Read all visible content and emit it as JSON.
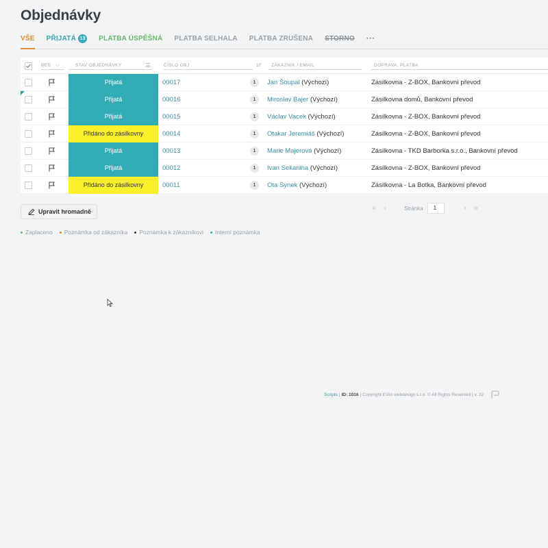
{
  "page": {
    "title": "Objednávky"
  },
  "tabs": [
    {
      "label": "VŠE",
      "state": "active"
    },
    {
      "label": "PŘIJATÁ",
      "badge": "13",
      "state": "received"
    },
    {
      "label": "PLATBA ÚSPĚŠNÁ",
      "state": "paid"
    },
    {
      "label": "PLATBA SELHALA",
      "state": "normal"
    },
    {
      "label": "PLATBA ZRUŠENA",
      "state": "normal"
    },
    {
      "label": "STORNO",
      "state": "storno"
    },
    {
      "label": "···",
      "state": "more"
    }
  ],
  "table": {
    "headers": {
      "flag": "BES",
      "status": "STAV OBJEDNÁVKY",
      "order": "ČÍSLO OBJ",
      "qty": "1F",
      "customer": "ZÁKAZNÍK / EMAIL",
      "shipping": "DOPRAVA, PLATBA"
    },
    "rows": [
      {
        "status": "Přijatá",
        "status_color": "teal",
        "order": "00017",
        "qty": "1",
        "customer_name": "Jan Šoupal",
        "customer_suffix": " (Výchozí)",
        "shipping": "Zásilkovna - Z-BOX, Bankovní převod"
      },
      {
        "status": "Přijatá",
        "status_color": "teal",
        "order": "00016",
        "qty": "1",
        "customer_name": "Miroslav Bajer",
        "customer_suffix": " (Výchozí)",
        "shipping": "Zásilkovna domů, Bankovní převod"
      },
      {
        "status": "Přijatá",
        "status_color": "teal",
        "order": "00015",
        "qty": "1",
        "customer_name": "Václav Vacek",
        "customer_suffix": " (Výchozí)",
        "shipping": "Zásilkovna - Z-BOX, Bankovní převod"
      },
      {
        "status": "Přidáno do zásilkovny",
        "status_color": "yellow",
        "order": "00014",
        "qty": "1",
        "customer_name": "Otakar Jeremiáš",
        "customer_suffix": " (Výchozí)",
        "shipping": "Zásilkovna - Z-BOX, Bankovní převod"
      },
      {
        "status": "Přijatá",
        "status_color": "teal",
        "order": "00013",
        "qty": "1",
        "customer_name": "Marie Majerová",
        "customer_suffix": " (Výchozí)",
        "shipping": "Zásilkovna - TKD Barborka s.r.o., Bankovní převod"
      },
      {
        "status": "Přijatá",
        "status_color": "teal",
        "order": "00012",
        "qty": "1",
        "customer_name": "Ivan Sekanina",
        "customer_suffix": " (Výchozí)",
        "shipping": "Zásilkovna - Z-BOX, Bankovní převod"
      },
      {
        "status": "Přidáno do zásilkovny",
        "status_color": "yellow",
        "order": "00011",
        "qty": "1",
        "customer_name": "Ota Synek",
        "customer_suffix": " (Výchozí)",
        "shipping": "Zásilkovna - La Botka, Bankovní převod"
      }
    ]
  },
  "actions": {
    "bulk_edit": "Upravit hromadně"
  },
  "pager": {
    "label": "Stránka",
    "page": "1"
  },
  "legend": [
    {
      "label": "Zaplaceno",
      "color": "#67b86b"
    },
    {
      "label": "Poznámka od zákazníka",
      "color": "#e38c2f"
    },
    {
      "label": "Poznámka k zákazníkovi",
      "color": "#333333"
    },
    {
      "label": "Interní poznámka",
      "color": "#3aa9bd"
    }
  ],
  "footer": {
    "link": "Scripts",
    "id_label": "ID: 1016",
    "text": " | Copyright EVici webdesign s.r.o. © All Rights Reserved | v. 32",
    "sep": " | "
  },
  "colors": {
    "accent": "#e38c2f",
    "teal_status": "#32acb4",
    "yellow_status": "#fbf12a",
    "link": "#3a8fa6"
  }
}
